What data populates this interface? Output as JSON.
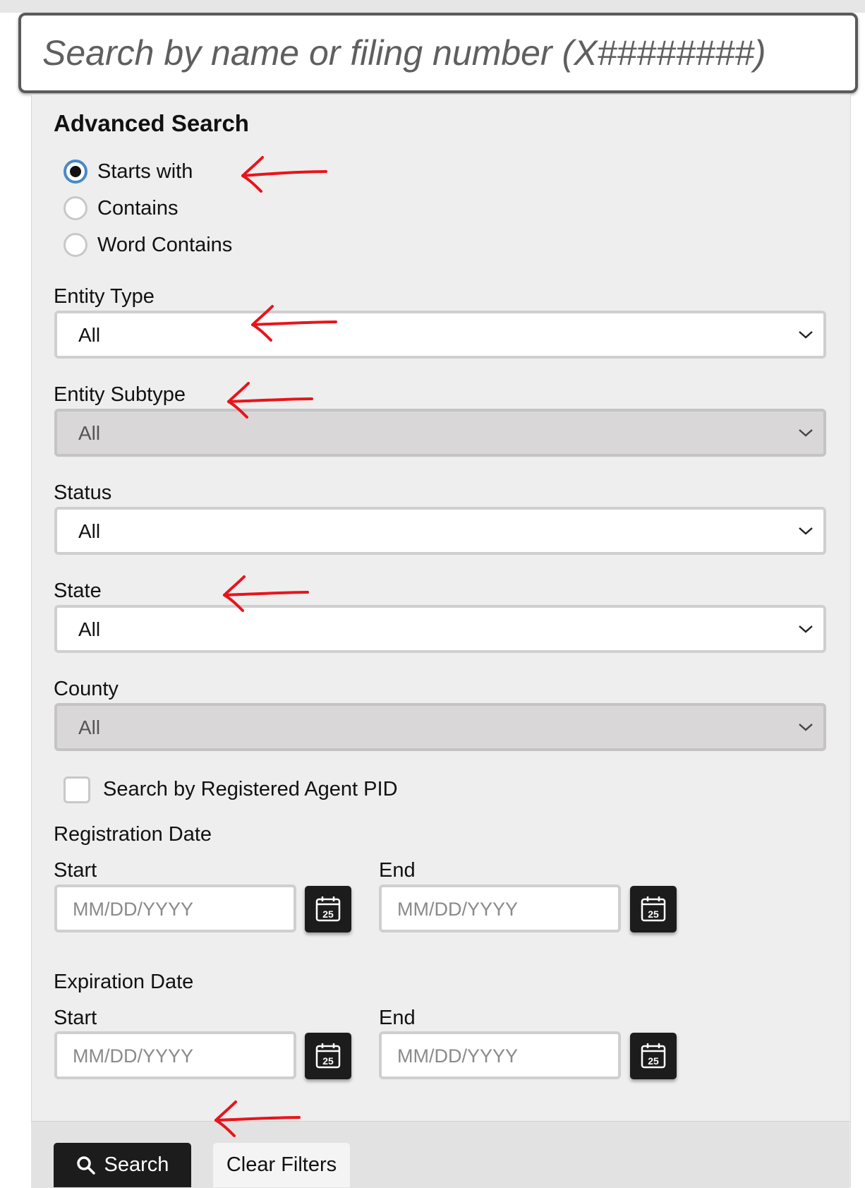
{
  "search": {
    "placeholder": "Search by name or filing number (X########)"
  },
  "advanced": {
    "title": "Advanced Search",
    "match_options": [
      {
        "label": "Starts with",
        "checked": true
      },
      {
        "label": "Contains",
        "checked": false
      },
      {
        "label": "Word Contains",
        "checked": false
      }
    ]
  },
  "filters": {
    "entity_type": {
      "label": "Entity Type",
      "value": "All",
      "disabled": false
    },
    "entity_subtype": {
      "label": "Entity Subtype",
      "value": "All",
      "disabled": true
    },
    "status": {
      "label": "Status",
      "value": "All",
      "disabled": false
    },
    "state": {
      "label": "State",
      "value": "All",
      "disabled": false
    },
    "county": {
      "label": "County",
      "value": "All",
      "disabled": true
    }
  },
  "agent_pid": {
    "label": "Search by Registered Agent PID",
    "checked": false
  },
  "registration_date": {
    "title": "Registration Date",
    "start_label": "Start",
    "end_label": "End",
    "start_placeholder": "MM/DD/YYYY",
    "end_placeholder": "MM/DD/YYYY"
  },
  "expiration_date": {
    "title": "Expiration Date",
    "start_label": "Start",
    "end_label": "End",
    "start_placeholder": "MM/DD/YYYY",
    "end_placeholder": "MM/DD/YYYY"
  },
  "calendar_icon_text": "25",
  "actions": {
    "search_label": "Search",
    "clear_label": "Clear Filters"
  },
  "colors": {
    "accent_radio": "#4a88c7",
    "annotation_arrow": "#e8141b",
    "button_dark": "#1c1c1c"
  }
}
